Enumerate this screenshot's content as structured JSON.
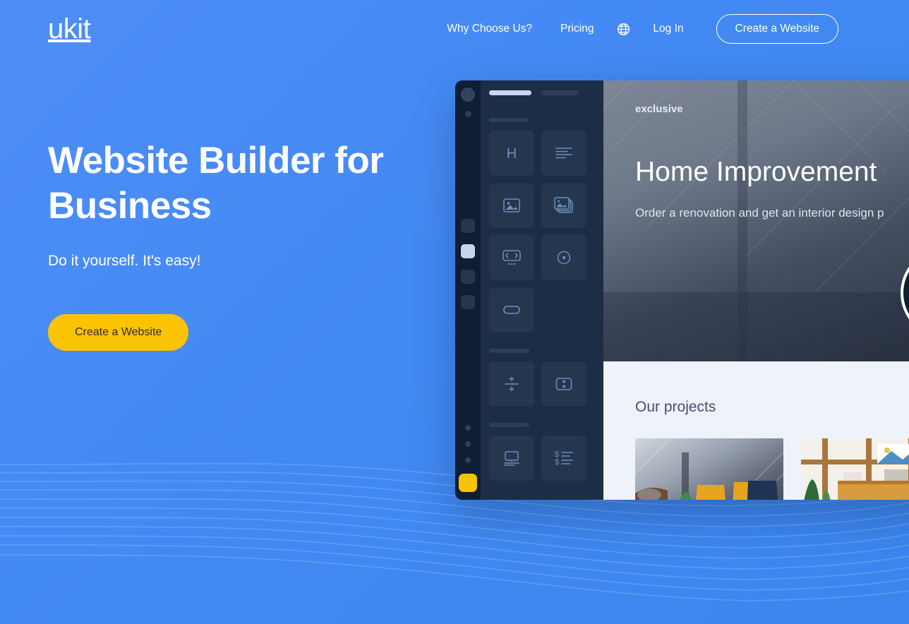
{
  "brand": {
    "logo": "ukit"
  },
  "nav": {
    "links": [
      {
        "label": "Why Choose Us?",
        "name": "nav-why-choose-us"
      },
      {
        "label": "Pricing",
        "name": "nav-pricing"
      }
    ],
    "language_icon": "globe-icon",
    "login_label": "Log In",
    "cta_label": "Create a Website"
  },
  "hero": {
    "title_line1": "Website Builder for",
    "title_line2": "Business",
    "subtitle": "Do it yourself. It's easy!",
    "cta_label": "Create a Website"
  },
  "editor": {
    "widgets": [
      {
        "name": "heading-widget",
        "icon": "heading-h-icon"
      },
      {
        "name": "text-widget",
        "icon": "text-lines-icon"
      },
      {
        "name": "image-widget",
        "icon": "image-icon"
      },
      {
        "name": "gallery-widget",
        "icon": "gallery-icon"
      },
      {
        "name": "slider-widget",
        "icon": "slider-icon"
      },
      {
        "name": "video-widget",
        "icon": "circle-dot-icon"
      },
      {
        "name": "button-widget",
        "icon": "button-pill-icon"
      },
      {
        "name": "divider-widget",
        "icon": "divider-icon"
      },
      {
        "name": "spacer-widget",
        "icon": "spacer-box-icon"
      },
      {
        "name": "media-widget",
        "icon": "monitor-icon"
      },
      {
        "name": "price-list-widget",
        "icon": "price-list-icon"
      }
    ]
  },
  "preview": {
    "kicker": "exclusive",
    "headline": "Home Improvement",
    "description": "Order a renovation and get an interior design p",
    "play_icon": "play-icon",
    "projects_title": "Our projects"
  },
  "colors": {
    "background_blue": "#4a8bf5",
    "accent_yellow": "#fbc403",
    "editor_dark": "#1c2d46",
    "rail_dark": "#0f1e33",
    "preview_light": "#eef2fa"
  }
}
